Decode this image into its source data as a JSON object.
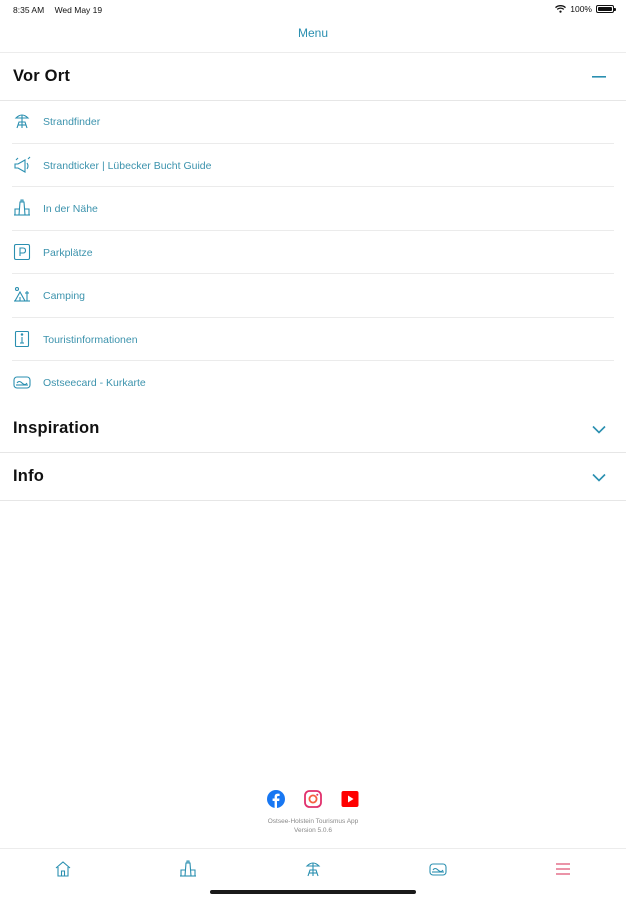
{
  "status_bar": {
    "time": "8:35 AM",
    "date": "Wed May 19",
    "battery": "100%",
    "battery_level": 1.0,
    "icons": [
      "wifi-icon",
      "battery-icon"
    ]
  },
  "nav": {
    "title": "Menu"
  },
  "colors": {
    "accent": "#2a8fb0",
    "tab_active": "#e05a7a",
    "facebook": "#1877f2",
    "instagram": "#e1306c",
    "youtube": "#ff0000"
  },
  "sections": {
    "vor_ort": {
      "title": "Vor Ort",
      "expanded": true,
      "items": [
        {
          "label": "Strandfinder",
          "icon": "beach-chair-icon"
        },
        {
          "label": "Strandticker | Lübecker Bucht Guide",
          "icon": "megaphone-icon"
        },
        {
          "label": "In der Nähe",
          "icon": "lighthouse-icon"
        },
        {
          "label": "Parkplätze",
          "icon": "parking-icon"
        },
        {
          "label": "Camping",
          "icon": "camping-icon"
        },
        {
          "label": "Touristinformationen",
          "icon": "info-icon"
        },
        {
          "label": "Ostseecard - Kurkarte",
          "icon": "card-icon"
        }
      ]
    },
    "inspiration": {
      "title": "Inspiration",
      "expanded": false
    },
    "info": {
      "title": "Info",
      "expanded": false
    }
  },
  "footer": {
    "social": [
      "facebook-icon",
      "instagram-icon",
      "youtube-icon"
    ],
    "app_name": "Ostsee-Holstein Tourismus App",
    "version": "Version 5.0.6"
  },
  "tab_bar": {
    "tabs": [
      {
        "icon": "home-icon",
        "active": false
      },
      {
        "icon": "lighthouse-icon",
        "active": false
      },
      {
        "icon": "beach-chair-icon",
        "active": false
      },
      {
        "icon": "card-icon",
        "active": false
      },
      {
        "icon": "menu-icon",
        "active": true
      }
    ]
  }
}
